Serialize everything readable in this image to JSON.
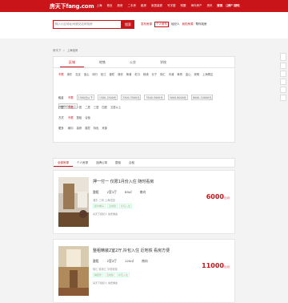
{
  "topbar": {
    "logo": "房天下fang.com",
    "city": "上海",
    "nav": [
      "首页",
      "新房",
      "二手房",
      "租房",
      "家居装修",
      "写字楼",
      "别墅",
      "海外房产",
      "资讯",
      "家具",
      "房产百科"
    ],
    "right": [
      "登录",
      "注册",
      "帮助"
    ]
  },
  "search": {
    "placeholder": "输入小区地址/地铁站名称找房",
    "button": "搜索",
    "links": [
      "发布房源",
      "个人房东",
      "经纪人",
      "我的房源",
      "帮你找房"
    ]
  },
  "breadcrumb": [
    "房天下",
    "上海租房"
  ],
  "filter": {
    "tabs": [
      "区域",
      "地铁",
      "公交",
      "学校"
    ],
    "rows": [
      {
        "label": "",
        "items": [
          "不限",
          "浦东",
          "嘉定",
          "宝山",
          "闵行",
          "松江",
          "普陀",
          "静安",
          "黄浦",
          "虹口",
          "杨浦",
          "长宁",
          "徐汇",
          "青浦",
          "奉贤",
          "金山",
          "崇明",
          "上海周边"
        ]
      },
      {
        "label": "租金",
        "items": [
          "不限",
          "1500元以下",
          "1500-2500元",
          "2500-3500元",
          "3500-5000元",
          "5000-8000元",
          "8000-10000元",
          "10000元以上"
        ]
      },
      {
        "label": "户型",
        "items": [
          "不限",
          "一居",
          "二居",
          "三居",
          "四居",
          "五居以上"
        ]
      },
      {
        "label": "方式",
        "items": [
          "不限",
          "整租",
          "合租"
        ]
      },
      {
        "label": "更多",
        "items": [
          "朝向",
          "装修",
          "楼层",
          "特色",
          "来源"
        ]
      }
    ]
  },
  "list": {
    "sort_tabs": [
      "全部房源",
      "个人房源",
      "品牌公寓",
      "整租",
      "合租"
    ],
    "cards": [
      {
        "title": "押一付一 仅限1月份入住 随时看房",
        "type": "整租",
        "rooms": "2室1厅",
        "area": "89㎡",
        "orient": "南向",
        "addr": "浦东-三林 上海花园",
        "tags": [
          "随时看房",
          "近地铁",
          "拎包入住"
        ],
        "agent": "房天下经纪人 免费佣金",
        "price": "6000",
        "unit": "元/月"
      },
      {
        "title": "整租精装2室2厅,拎包入住 近地铁 看房方便",
        "type": "整租",
        "rooms": "2室2厅",
        "area": "120㎡",
        "orient": "南向",
        "addr": "徐汇-徐家汇 华丽家族",
        "tags": [
          "精装修",
          "近地铁",
          "拎包入住"
        ],
        "agent": "房天下经纪人 免费佣金",
        "price": "11000",
        "unit": "元/月"
      }
    ]
  },
  "colors": {
    "brand": "#c9141a"
  }
}
